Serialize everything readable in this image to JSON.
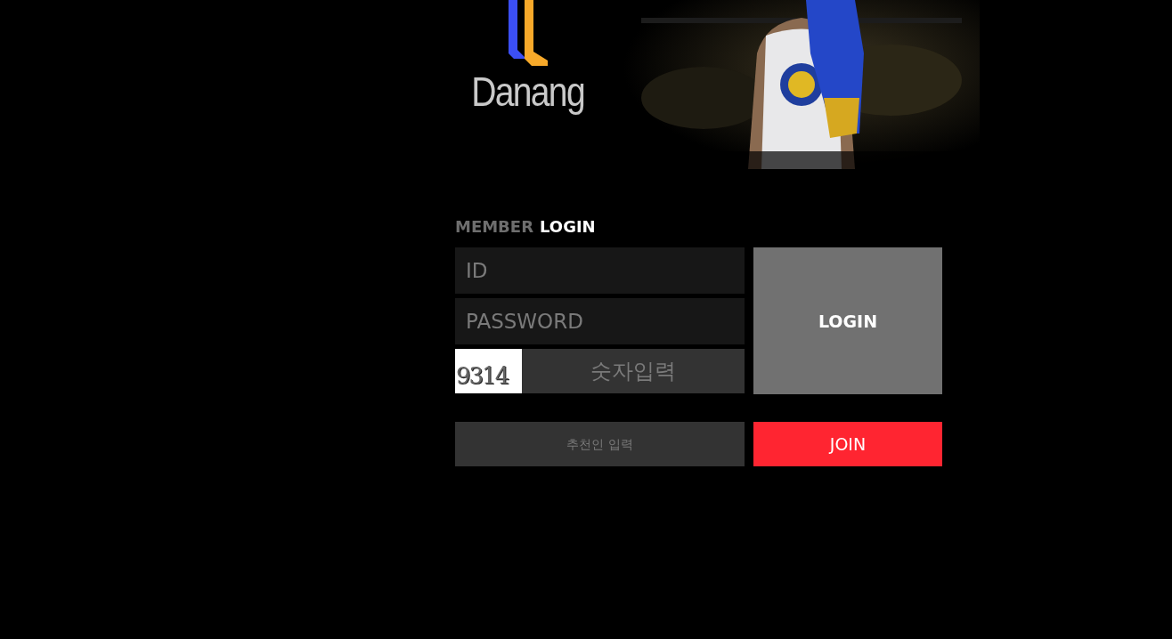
{
  "logo": {
    "text": "Danang"
  },
  "login_form": {
    "title_lead": "MEMBER",
    "title_main": "LOGIN",
    "id_field": {
      "placeholder": "ID"
    },
    "password_field": {
      "placeholder": "PASSWORD"
    },
    "captcha": {
      "code": "9314"
    },
    "captcha_field": {
      "placeholder": "숫자입력"
    },
    "login_button": "LOGIN",
    "recommender_field": {
      "placeholder": "추천인 입력"
    },
    "join_button": "JOIN"
  }
}
